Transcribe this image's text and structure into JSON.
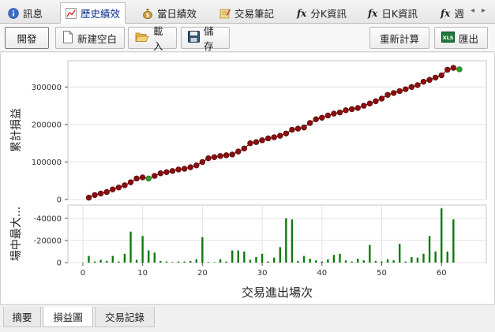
{
  "tabs": [
    {
      "label": "訊息",
      "icon": "info-icon",
      "active": false
    },
    {
      "label": "歷史績效",
      "icon": "line-chart-icon",
      "active": true
    },
    {
      "label": "當日績效",
      "icon": "money-bag-icon",
      "active": false
    },
    {
      "label": "交易筆記",
      "icon": "notebook-icon",
      "active": false
    },
    {
      "label": "分K資訊",
      "icon": "function-icon",
      "fx": "fx",
      "active": false
    },
    {
      "label": "日K資訊",
      "icon": "function-icon",
      "fx": "fx",
      "active": false
    },
    {
      "label": "週",
      "icon": "function-icon",
      "fx": "fx",
      "active": false
    }
  ],
  "toolbar": {
    "develop_label": "開發",
    "new_blank_label": "新建空白",
    "load_label": "載入",
    "save_label": "儲存",
    "recalc_label": "重新計算",
    "export_label": "匯出",
    "export_icon_text": "XLS"
  },
  "colors": {
    "point_red": "#8b0d0d",
    "point_green": "#2e9e2e",
    "bar_green": "#0f7a0f",
    "grid": "#e2e2e2"
  },
  "chart_data": [
    {
      "type": "line",
      "ylabel": "累計損益",
      "xlabel": "",
      "ylim": [
        0,
        370000
      ],
      "yticks": [
        0,
        100000,
        200000,
        300000
      ],
      "ytick_labels": [
        "0",
        "100000",
        "200000",
        "300000"
      ],
      "grid": true,
      "x": [
        1,
        2,
        3,
        4,
        5,
        6,
        7,
        8,
        9,
        10,
        11,
        12,
        13,
        14,
        15,
        16,
        17,
        18,
        19,
        20,
        21,
        22,
        23,
        24,
        25,
        26,
        27,
        28,
        29,
        30,
        31,
        32,
        33,
        34,
        35,
        36,
        37,
        38,
        39,
        40,
        41,
        42,
        43,
        44,
        45,
        46,
        47,
        48,
        49,
        50,
        51,
        52,
        53,
        54,
        55,
        56,
        57,
        58,
        59,
        60,
        61,
        62,
        63
      ],
      "y": [
        5000,
        12000,
        16000,
        20000,
        27000,
        32000,
        38000,
        46000,
        56000,
        59000,
        56000,
        63000,
        70000,
        73000,
        76000,
        80000,
        82000,
        86000,
        91000,
        100000,
        110000,
        113000,
        116000,
        118000,
        120000,
        128000,
        136000,
        150000,
        153000,
        158000,
        163000,
        166000,
        170000,
        176000,
        186000,
        189000,
        192000,
        204000,
        214000,
        218000,
        224000,
        229000,
        232000,
        238000,
        241000,
        244000,
        250000,
        256000,
        262000,
        269000,
        279000,
        284000,
        289000,
        294000,
        300000,
        305000,
        314000,
        319000,
        325000,
        331000,
        346000,
        351000,
        347000
      ],
      "green_points_x": [
        11,
        63
      ]
    },
    {
      "type": "bar",
      "ylabel": "場中最大...",
      "xlabel": "交易進出場次",
      "ylim": [
        0,
        52000
      ],
      "yticks": [
        0,
        20000,
        40000
      ],
      "ytick_labels": [
        "0",
        "-20000",
        "-40000"
      ],
      "xticks": [
        0,
        10,
        20,
        30,
        40,
        50,
        60
      ],
      "xtick_labels": [
        "0",
        "10",
        "20",
        "30",
        "40",
        "50",
        "60"
      ],
      "grid": true,
      "x": [
        1,
        2,
        3,
        4,
        5,
        6,
        7,
        8,
        9,
        10,
        11,
        12,
        13,
        14,
        15,
        16,
        17,
        18,
        19,
        20,
        21,
        22,
        23,
        24,
        25,
        26,
        27,
        28,
        29,
        30,
        31,
        32,
        33,
        34,
        35,
        36,
        37,
        38,
        39,
        40,
        41,
        42,
        43,
        44,
        45,
        46,
        47,
        48,
        49,
        50,
        51,
        52,
        53,
        54,
        55,
        56,
        57,
        58,
        59,
        60,
        61,
        62,
        63
      ],
      "values": [
        6000,
        1000,
        2500,
        1500,
        6000,
        1000,
        8000,
        28000,
        2500,
        24000,
        11000,
        9000,
        1500,
        1000,
        500,
        1000,
        1000,
        1500,
        3000,
        23000,
        500,
        500,
        3000,
        1000,
        11000,
        11000,
        10000,
        2500,
        5000,
        8000,
        1000,
        4500,
        14000,
        40000,
        39000,
        1500,
        6000,
        3500,
        2000,
        1000,
        3000,
        7000,
        8000,
        2000,
        1000,
        3500,
        2000,
        16000,
        1500,
        1000,
        3000,
        2000,
        17000,
        1000,
        5000,
        4500,
        8000,
        24000,
        10000,
        49000,
        10000,
        39000,
        0
      ]
    }
  ],
  "bottom_tabs": [
    {
      "label": "摘要",
      "active": false
    },
    {
      "label": "損益圖",
      "active": true
    },
    {
      "label": "交易記錄",
      "active": false
    }
  ]
}
